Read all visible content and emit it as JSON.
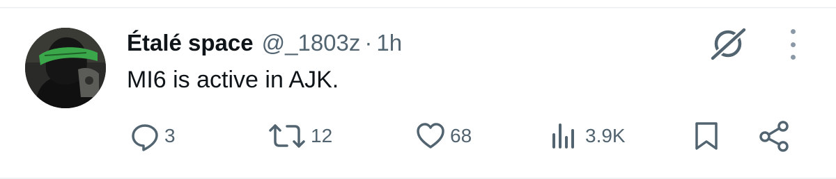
{
  "tweet": {
    "author": {
      "display_name": "Étalé space",
      "handle": "@_1803z",
      "separator": "·",
      "timestamp": "1h"
    },
    "text": "MI6 is active in AJK.",
    "actions": {
      "reply": {
        "icon": "reply-icon",
        "count": "3"
      },
      "retweet": {
        "icon": "retweet-icon",
        "count": "12"
      },
      "like": {
        "icon": "heart-icon",
        "count": "68"
      },
      "views": {
        "icon": "views-icon",
        "count": "3.9K"
      },
      "bookmark": {
        "icon": "bookmark-icon"
      },
      "share": {
        "icon": "share-icon"
      }
    },
    "header_icons": [
      "grok-icon",
      "more-vertical-icon"
    ]
  },
  "colors": {
    "text_primary": "#0f1419",
    "text_secondary": "#536471",
    "divider": "#eff3f4",
    "avatar_headband": "#3aa84a"
  }
}
